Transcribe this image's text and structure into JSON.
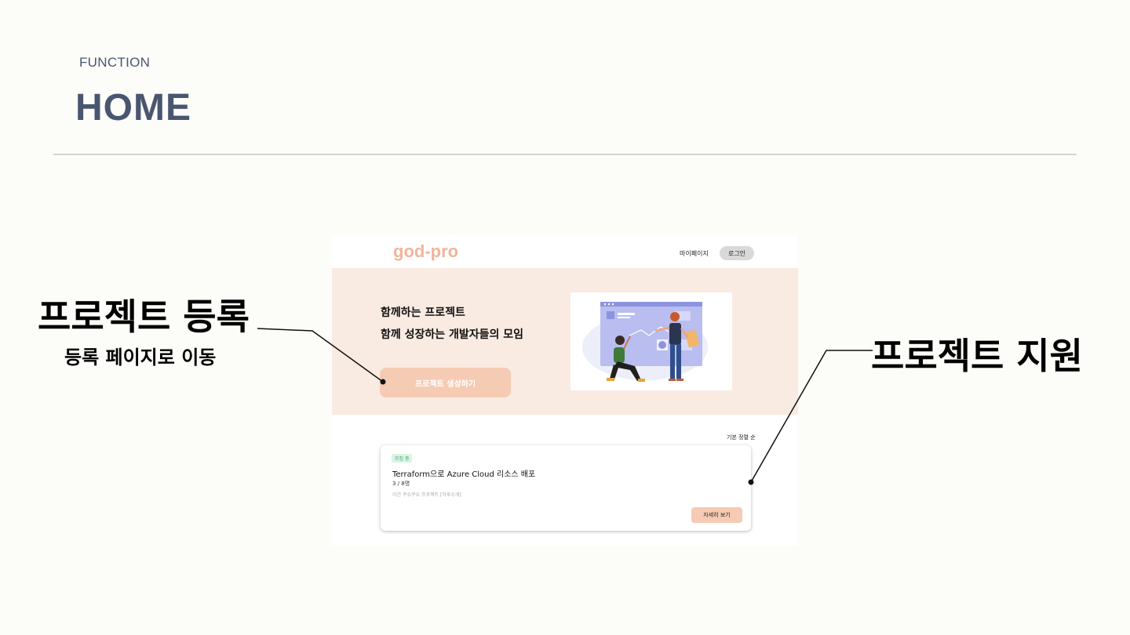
{
  "slide": {
    "subtitle": "FUNCTION",
    "title": "HOME"
  },
  "annotations": {
    "left_title": "프로젝트 등록",
    "left_sub": "등록 페이지로 이동",
    "right_title": "프로젝트 지원"
  },
  "mockup": {
    "nav": {
      "logo": "god-pro",
      "mypage": "마이페이지",
      "login": "로그인"
    },
    "hero": {
      "line1": "함께하는 프로젝트",
      "line2": "함께 성장하는 개발자들의 모임",
      "create_button": "프로젝트 생성하기"
    },
    "sort_label": "기본 정렬 순",
    "card": {
      "badge": "모집 중",
      "title": "Terraform으로 Azure Cloud 리소스 배포",
      "count": "3 / 8명",
      "description": "이건 쿠슈쿠슈 프로젝트 [하루소개]",
      "detail_button": "자세히 보기"
    }
  },
  "colors": {
    "accent": "#f6cbb3",
    "logo": "#f2b49c",
    "hero_bg": "#f9ebe2",
    "title": "#4a5670"
  }
}
